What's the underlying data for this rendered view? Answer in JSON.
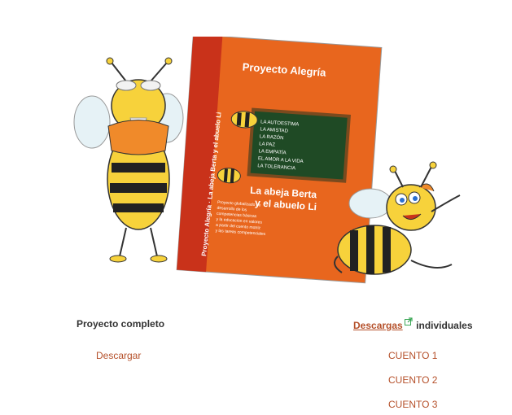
{
  "illustration": {
    "book_series": "Proyecto Alegría",
    "book_title_line1": "La abeja Berta",
    "book_title_line2": "y el abuelo Li",
    "spine_text": "Proyecto Alegría · La abeja Berta y el abuelo Li",
    "blackboard_lines": [
      "LA AUTOESTIMA",
      "LA AMISTAD",
      "LA RAZÓN",
      "LA PAZ",
      "LA EMPATÍA",
      "EL AMOR A LA VIDA",
      "LA TOLERANCIA"
    ],
    "cover_blurb": [
      "Proyecto globalizado de",
      "desarrollo de los",
      "competencias básicas",
      "y la educación en valores",
      "a partir del cuento motriz",
      "y las tareas competenciales"
    ]
  },
  "left_section": {
    "title": "Proyecto completo",
    "download_label": "Descargar"
  },
  "right_section": {
    "downloads_link": "Descargas",
    "title_suffix": "individuales",
    "stories": [
      "CUENTO 1",
      "CUENTO 2",
      "CUENTO 3"
    ]
  },
  "colors": {
    "link": "#b5502a",
    "text": "#333333",
    "cover_orange": "#e8661e",
    "cover_red": "#c9321a",
    "blackboard": "#1f4a25",
    "bee_yellow": "#f7d23b",
    "ext_icon_green": "#3aa655"
  }
}
